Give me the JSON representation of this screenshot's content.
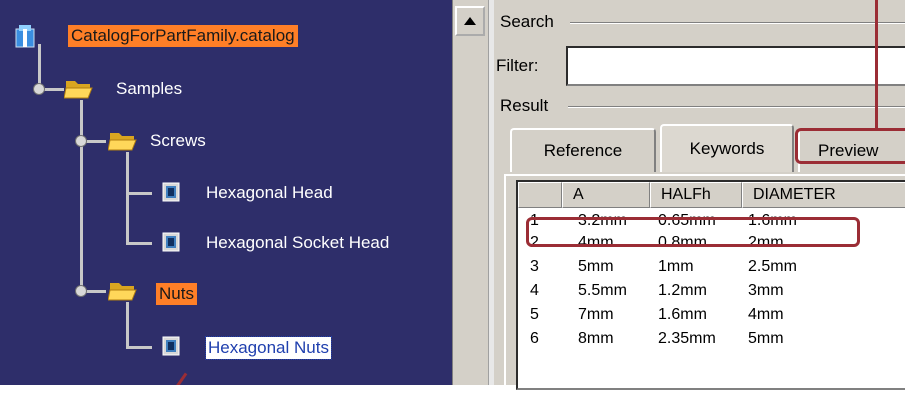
{
  "tree": {
    "root": "CatalogForPartFamily.catalog",
    "samples": "Samples",
    "screws": "Screws",
    "hex_head": "Hexagonal Head",
    "hex_socket": "Hexagonal Socket Head",
    "nuts": "Nuts",
    "hex_nuts": "Hexagonal Nuts"
  },
  "search": {
    "group_label": "Search",
    "filter_label": "Filter:",
    "filter_value": ""
  },
  "result": {
    "group_label": "Result",
    "tabs": [
      "Reference",
      "Keywords",
      "Preview"
    ],
    "columns": [
      "",
      "A",
      "HALFh",
      "DIAMETER"
    ],
    "rows": [
      [
        "1",
        "3.2mm",
        "0.65mm",
        "1.6mm"
      ],
      [
        "2",
        "4mm",
        "0.8mm",
        "2mm"
      ],
      [
        "3",
        "5mm",
        "1mm",
        "2.5mm"
      ],
      [
        "4",
        "5.5mm",
        "1.2mm",
        "3mm"
      ],
      [
        "5",
        "7mm",
        "1.6mm",
        "4mm"
      ],
      [
        "6",
        "8mm",
        "2.35mm",
        "5mm"
      ]
    ]
  },
  "colors": {
    "tree_bg": "#2e2e6a",
    "highlight_orange": "#ff7f27",
    "annotation_red": "#9b2d35",
    "panel_gray": "#d4d0c8"
  }
}
